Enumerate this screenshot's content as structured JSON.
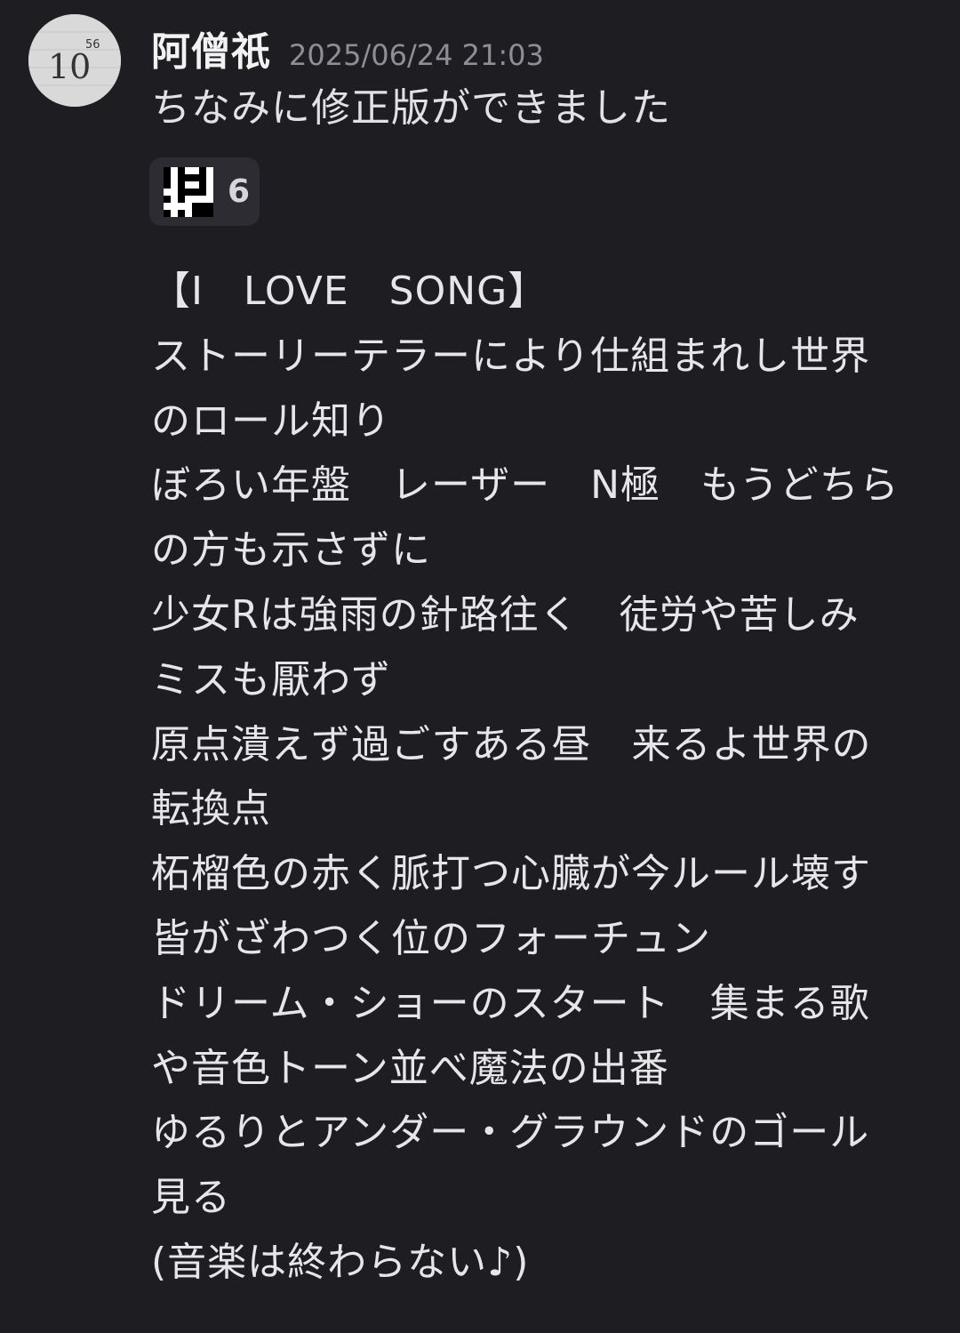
{
  "message": {
    "author": "阿僧祇",
    "timestamp": "2025/06/24 21:03",
    "avatar_text": "10",
    "avatar_superscript": "56",
    "first_line": "ちなみに修正版ができました",
    "reaction": {
      "emoji": "pixel-kanji-emoji",
      "count": "6"
    },
    "lyrics": [
      "【I　LOVE　SONG】",
      "ストーリーテラーにより仕組まれし世界",
      "のロール知り",
      "ぼろい年盤　レーザー　N極　もうどちら",
      "の方も示さずに",
      "少女Rは強雨の針路往く　徒労や苦しみ",
      "ミスも厭わず",
      "原点潰えず過ごすある昼　来るよ世界の",
      "転換点",
      "柘榴色の赤く脈打つ心臓が今ルール壊す",
      "皆がざわつく位のフォーチュン",
      "ドリーム・ショーのスタート　集まる歌",
      "や音色トーン並べ魔法の出番",
      "ゆるりとアンダー・グラウンドのゴール",
      "見る",
      "(音楽は終わらない♪)"
    ]
  },
  "colors": {
    "background": "#1e1e22",
    "reaction_bg": "#2c2c32",
    "timestamp": "#8e8e95",
    "text": "#e6e6e9"
  }
}
